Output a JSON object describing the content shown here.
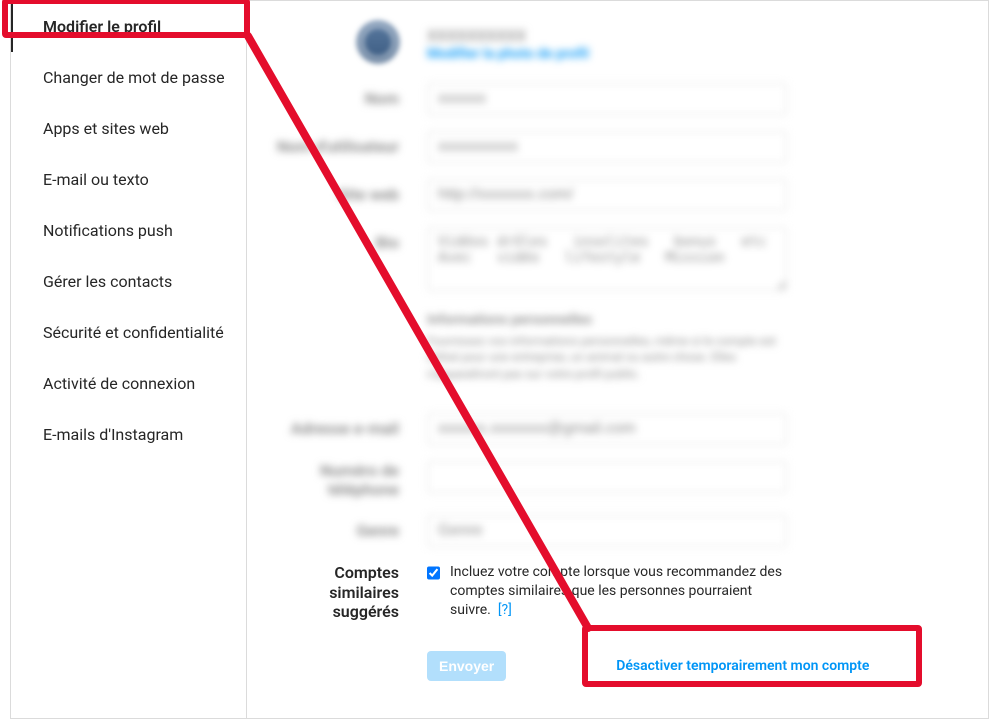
{
  "sidebar": {
    "items": [
      {
        "label": "Modifier le profil",
        "active": true
      },
      {
        "label": "Changer de mot de passe"
      },
      {
        "label": "Apps et sites web"
      },
      {
        "label": "E-mail ou texto"
      },
      {
        "label": "Notifications push"
      },
      {
        "label": "Gérer les contacts"
      },
      {
        "label": "Sécurité et confidentialité"
      },
      {
        "label": "Activité de connexion"
      },
      {
        "label": "E-mails d'Instagram"
      }
    ]
  },
  "profile": {
    "username_display": "xxxxxxxxxx",
    "change_photo": "Modifier la photo de profil"
  },
  "fields": {
    "name_label": "Nom",
    "name_value": "xxxxxx",
    "username_label": "Nom d'utilisateur",
    "username_value": "xxxxxxxxxx",
    "website_label": "Site web",
    "website_value": "http://xxxxxxx.com/",
    "bio_label": "Bio",
    "bio_value": "Vidéos drôles   insolites   bonus   etc  Avec   vidéo   lifestyle   Mission",
    "personal_info_title": "Informations personnelles",
    "personal_info_text": "Fournissez vos informations personnelles, même si le compte est utilisé pour une entreprise, un animal ou autre chose. Elles n'apparaîtront pas sur votre profil public.",
    "email_label": "Adresse e-mail",
    "email_value": "xxxxxx.xxxxxxx@gmail.com",
    "phone_label": "Numéro de téléphone",
    "phone_value": "",
    "gender_label": "Genre",
    "gender_value": "Genre",
    "similar_label_l1": "Comptes",
    "similar_label_l2": "similaires",
    "similar_label_l3": "suggérés",
    "similar_text": "Incluez votre compte lorsque vous recommandez des comptes similaires que les personnes pourraient suivre.",
    "similar_help": "[?]"
  },
  "actions": {
    "submit": "Envoyer",
    "deactivate": "Désactiver temporairement mon compte"
  }
}
